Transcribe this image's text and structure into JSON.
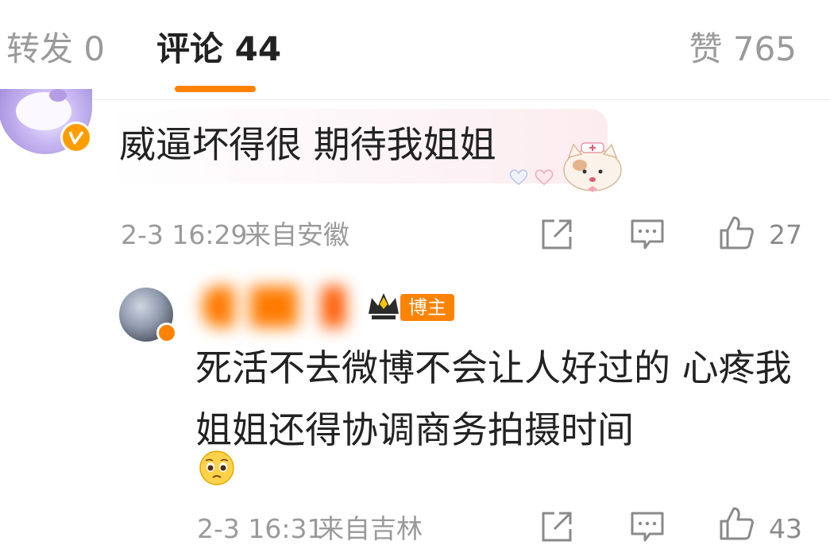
{
  "tabs": [
    {
      "label": "转发 0"
    },
    {
      "label": "评论 44"
    },
    {
      "label": "赞 765"
    }
  ],
  "colors": {
    "accent": "#ff8200",
    "muted": "#9a9a9a",
    "text": "#222222"
  },
  "comments": [
    {
      "text": "威逼坏得很 期待我姐姐",
      "time": "2-3 16:29",
      "location": "来自安徽",
      "likes": "27",
      "avatar_icon": "hello-kitty-avatar",
      "badge_icon": "vip-badge-icon"
    },
    {
      "author_badge": "博主",
      "text": "死活不去微博不会让人好过的  心疼我姐姐还得协调商务拍摄时间",
      "emoji": "pleading-face-emoji",
      "time": "2-3 16:31",
      "location": "来自吉林",
      "likes": "43"
    }
  ]
}
